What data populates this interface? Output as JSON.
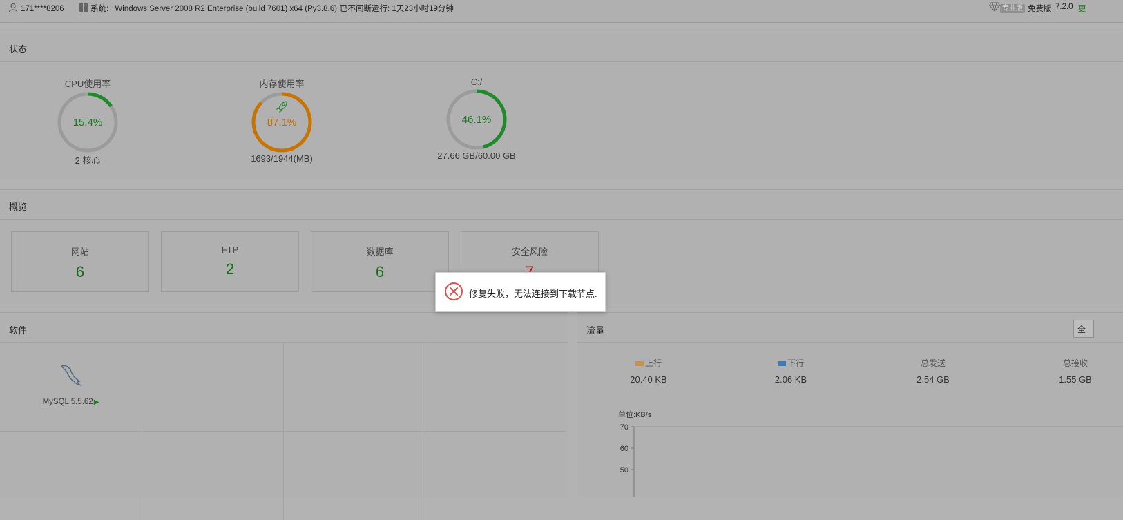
{
  "topbar": {
    "user": "171****8206",
    "system_label": "系统:",
    "system_value": "Windows Server 2008 R2 Enterprise (build 7601) x64 (Py3.8.6)",
    "uptime": "已不间断运行: 1天23小时19分钟",
    "pro_badge": "专业版",
    "free_label": "免费版",
    "version": "7.2.0",
    "update_fragment": "更"
  },
  "status": {
    "title": "状态",
    "gauges": [
      {
        "title": "CPU使用率",
        "value": "15.4%",
        "percent": 15.4,
        "sub": "2 核心",
        "color": "#1f8a2a",
        "text_color": "#167a1c"
      },
      {
        "title": "内存使用率",
        "value": "87.1%",
        "percent": 87.1,
        "sub": "1693/1944(MB)",
        "color": "#c77400",
        "text_color": "#c06d00"
      },
      {
        "title": "C:/",
        "value": "46.1%",
        "percent": 46.1,
        "sub": "27.66 GB/60.00 GB",
        "color": "#1f8a2a",
        "text_color": "#167a1c"
      }
    ]
  },
  "overview": {
    "title": "概览",
    "cards": [
      {
        "label": "网站",
        "value": "6"
      },
      {
        "label": "FTP",
        "value": "2"
      },
      {
        "label": "数据库",
        "value": "6"
      },
      {
        "label": "安全风险",
        "value": "7"
      }
    ]
  },
  "software": {
    "title": "软件",
    "items": [
      {
        "name": "MySQL 5.5.62"
      }
    ]
  },
  "traffic": {
    "title": "流量",
    "button_fragment": "全",
    "stats": [
      {
        "label": "上行",
        "value": "20.40 KB",
        "swatch": "#c8953b"
      },
      {
        "label": "下行",
        "value": "2.06 KB",
        "swatch": "#3a7dbf"
      },
      {
        "label": "总发送",
        "value": "2.54 GB"
      },
      {
        "label": "总接收",
        "value": "1.55 GB"
      }
    ],
    "chart_data": {
      "type": "line",
      "ylabel": "单位:KB/s",
      "yticks": [
        "70",
        "60",
        "50"
      ],
      "ylim": [
        50,
        70
      ],
      "series": []
    }
  },
  "toast": {
    "message": "修复失败，无法连接到下载节点."
  }
}
